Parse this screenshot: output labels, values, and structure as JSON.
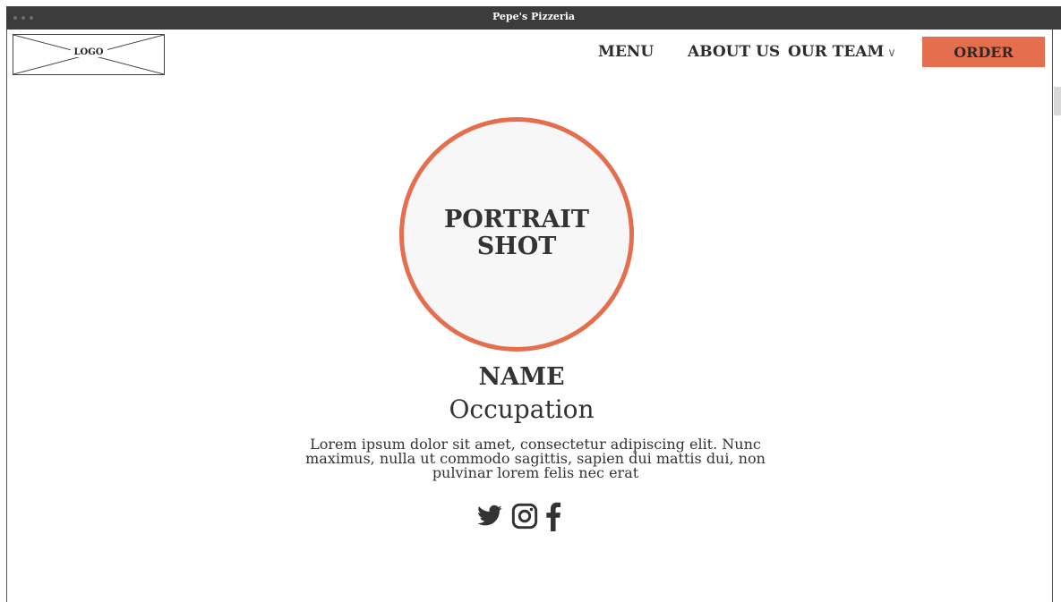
{
  "window": {
    "title": "Pepe's Pizzeria"
  },
  "header": {
    "logo_text": "LOGO",
    "nav": {
      "menu": "MENU",
      "about": "ABOUT US",
      "team": "OUR TEAM",
      "team_chevron": "∨"
    },
    "order_label": "ORDER"
  },
  "profile": {
    "portrait_text": "PORTRAIT SHOT",
    "name": "NAME",
    "occupation": "Occupation",
    "bio": "Lorem ipsum dolor sit amet, consectetur adipiscing elit. Nunc maximus, nulla ut commodo sagittis, sapien dui mattis dui, non pulvinar lorem felis nec erat",
    "socials": [
      "twitter-icon",
      "instagram-icon",
      "facebook-icon"
    ]
  },
  "colors": {
    "accent": "#e56e4f",
    "titlebar": "#3c3c3c",
    "text": "#333333"
  }
}
